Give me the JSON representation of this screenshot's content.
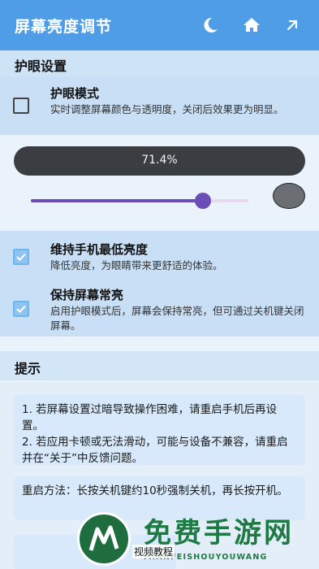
{
  "header": {
    "title": "屏幕亮度调节"
  },
  "eye_section": {
    "title": "护眼设置",
    "eye_mode": {
      "title": "护眼模式",
      "desc": "实时调整屏幕颜色与透明度，关闭后效果更为明显。",
      "checked": false
    },
    "brightness_value": "71.4%",
    "slider_level": 0.79
  },
  "options": [
    {
      "title": "维持手机最低亮度",
      "desc": "降低亮度，为眼睛带来更舒适的体验。",
      "checked": true
    },
    {
      "title": "保持屏幕常亮",
      "desc": "启用护眼模式后，屏幕会保持常亮，但可通过关机键关闭屏幕。",
      "checked": true
    }
  ],
  "tips": {
    "title": "提示",
    "box1": "1. 若屏幕设置过暗导致操作困难，请重启手机后再设置。\n2. 若应用卡顿或无法滑动，可能与设备不兼容，请重启并在“关于”中反馈问题。",
    "box2": "重启方法：长按关机键约10秒强制关机，再长按开机。"
  },
  "watermark": {
    "brand": "免费手游网",
    "domain": "MIANFEISHOUYOUWANG",
    "video_label": "视频教程"
  },
  "colors": {
    "primary": "#4f9de6",
    "section": "#cfe3f6",
    "card": "#c8dff5",
    "slider": "#6a4eb5"
  },
  "icons": [
    "moon-icon",
    "home-icon",
    "share-arrow-icon",
    "check-icon"
  ]
}
